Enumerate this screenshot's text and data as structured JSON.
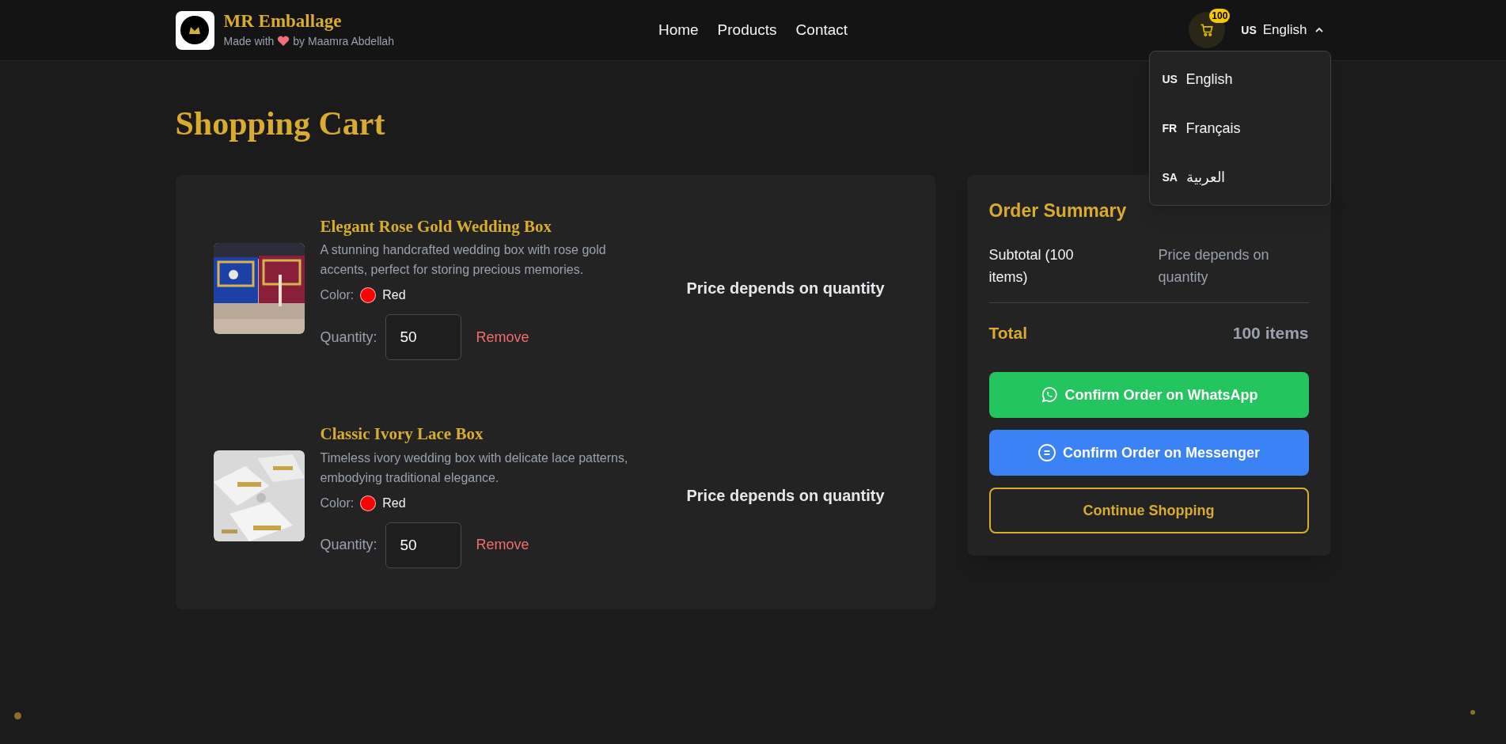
{
  "header": {
    "brand": "MR Emballage",
    "tagline_before": "Made with",
    "tagline_after": "by Maamra Abdellah",
    "nav": [
      {
        "label": "Home"
      },
      {
        "label": "Products"
      },
      {
        "label": "Contact"
      }
    ],
    "cart_count": "100",
    "language": {
      "code": "US",
      "label": "English",
      "expanded": true
    }
  },
  "language_menu": [
    {
      "code": "US",
      "label": "English"
    },
    {
      "code": "FR",
      "label": "Français"
    },
    {
      "code": "SA",
      "label": "العربية"
    }
  ],
  "page_title": "Shopping Cart",
  "cart_items": [
    {
      "name": "Elegant Rose Gold Wedding Box",
      "description": "A stunning handcrafted wedding box with rose gold accents, perfect for storing precious memories.",
      "color_label": "Color:",
      "color_name": "Red",
      "color": "#ff0000",
      "quantity_label": "Quantity:",
      "quantity": "50",
      "remove": "Remove",
      "price": "Price depends on quantity"
    },
    {
      "name": "Classic Ivory Lace Box",
      "description": "Timeless ivory wedding box with delicate lace patterns, embodying traditional elegance.",
      "color_label": "Color:",
      "color_name": "Red",
      "color": "#ff0000",
      "quantity_label": "Quantity:",
      "quantity": "50",
      "remove": "Remove",
      "price": "Price depends on quantity"
    }
  ],
  "order_summary": {
    "title": "Order Summary",
    "subtotal_label": "Subtotal (100 items)",
    "subtotal_value": "Price depends on quantity",
    "total_label": "Total",
    "total_value": "100 items",
    "buttons": [
      {
        "kind": "whatsapp",
        "label": "Confirm Order on WhatsApp"
      },
      {
        "kind": "messenger",
        "label": "Confirm Order on Messenger"
      },
      {
        "kind": "outline",
        "label": "Continue Shopping"
      }
    ]
  }
}
